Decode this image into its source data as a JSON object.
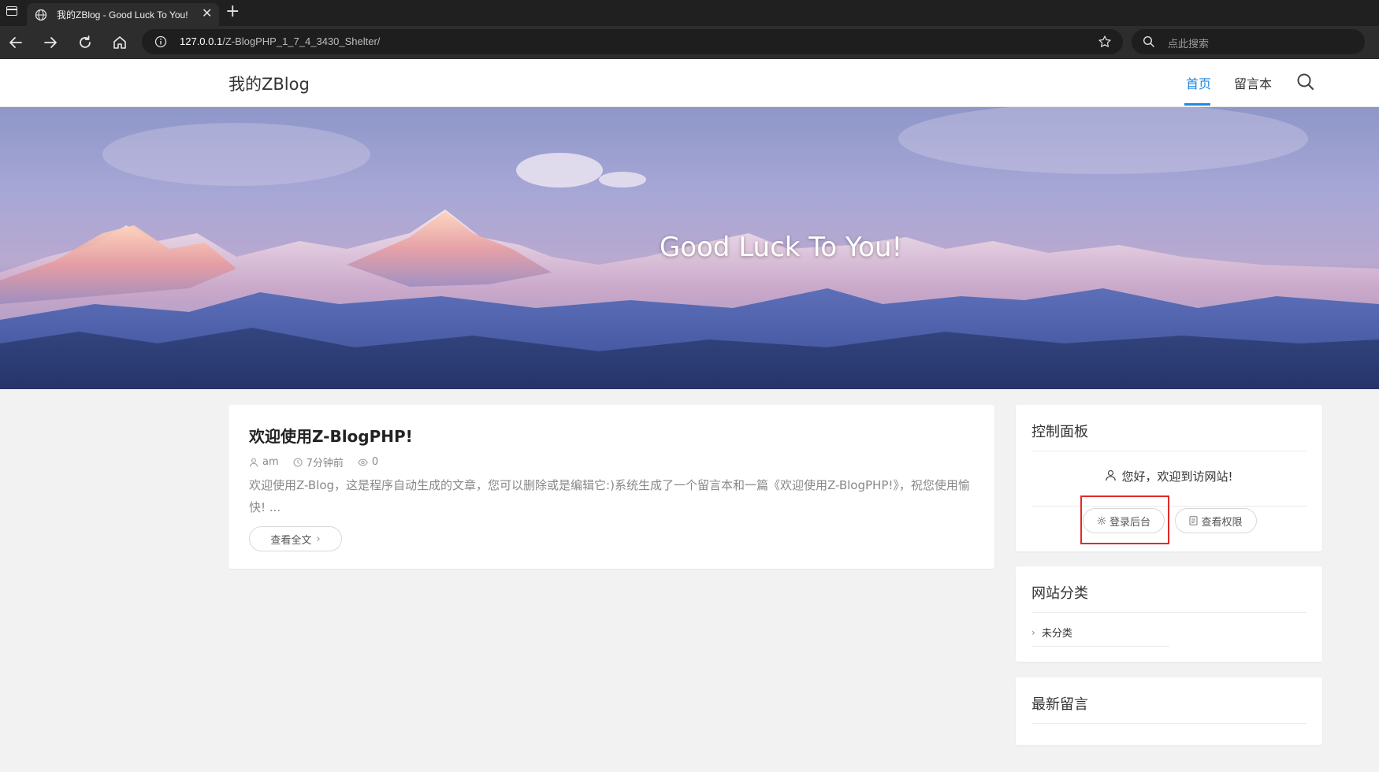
{
  "browser": {
    "tab_title": "我的ZBlog - Good Luck To You!",
    "tab_close": "✕",
    "new_tab": "+",
    "url_host": "127.0.0.1",
    "url_path": "/Z-BlogPHP_1_7_4_3430_Shelter/",
    "search_placeholder": "点此搜索"
  },
  "site": {
    "title": "我的ZBlog",
    "nav": [
      {
        "label": "首页",
        "active": true
      },
      {
        "label": "留言本",
        "active": false
      }
    ],
    "accent": "#1e88e5",
    "tagline": "Good Luck To You!"
  },
  "post": {
    "title": "欢迎使用Z-BlogPHP!",
    "author": "am",
    "time": "7分钟前",
    "views": "0",
    "excerpt": "欢迎使用Z-Blog，这是程序自动生成的文章，您可以删除或是编辑它:)系统生成了一个留言本和一篇《欢迎使用Z-BlogPHP!》，祝您使用愉快! ...",
    "read_more": "查看全文",
    "read_more_icon": "›"
  },
  "sidebar": {
    "panel_title": "控制面板",
    "welcome": "您好，欢迎到访网站!",
    "login_button": "登录后台",
    "permissions_button": "查看权限",
    "highlight_color": "#e02b2b",
    "categories_title": "网站分类",
    "categories": [
      {
        "label": "未分类",
        "icon": "›"
      }
    ],
    "comments_title": "最新留言"
  }
}
